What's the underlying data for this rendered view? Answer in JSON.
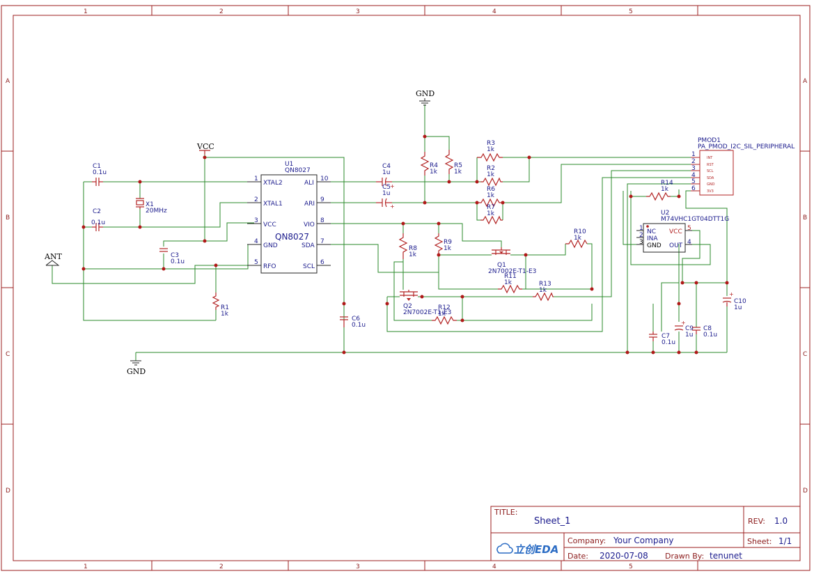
{
  "zones": {
    "columns": [
      "1",
      "2",
      "3",
      "4",
      "5"
    ],
    "rows": [
      "A",
      "B",
      "C",
      "D"
    ]
  },
  "labels": {
    "vcc": "VCC",
    "gnd_top": "GND",
    "gnd_bottom": "GND",
    "ant": "ANT"
  },
  "u1": {
    "ref": "U1",
    "part": "QN8027",
    "body_name": "QN8027",
    "left_pins": [
      {
        "num": "1",
        "name": "XTAL2"
      },
      {
        "num": "2",
        "name": "XTAL1"
      },
      {
        "num": "3",
        "name": "VCC"
      },
      {
        "num": "4",
        "name": "GND"
      },
      {
        "num": "5",
        "name": "RFO"
      }
    ],
    "right_pins": [
      {
        "num": "10",
        "name": "ALI"
      },
      {
        "num": "9",
        "name": "ARI"
      },
      {
        "num": "8",
        "name": "VIO"
      },
      {
        "num": "7",
        "name": "SDA"
      },
      {
        "num": "6",
        "name": "SCL"
      }
    ]
  },
  "u2": {
    "ref": "U2",
    "part": "M74VHC1GT04DTT1G",
    "pins": [
      {
        "num": "1",
        "name": "NC"
      },
      {
        "num": "2",
        "name": "INA"
      },
      {
        "num": "3",
        "name": "GND"
      },
      {
        "num": "5",
        "name": "VCC"
      },
      {
        "num": "4",
        "name": "OUT"
      }
    ]
  },
  "pmod": {
    "ref": "PMOD1",
    "part": "PA_PMOD_I2C_SIL_PERIPHERAL",
    "pins": [
      {
        "num": "1",
        "name": "INT"
      },
      {
        "num": "2",
        "name": "RST"
      },
      {
        "num": "3",
        "name": "SCL"
      },
      {
        "num": "4",
        "name": "SDA"
      },
      {
        "num": "5",
        "name": "GND"
      },
      {
        "num": "6",
        "name": "3V3"
      }
    ]
  },
  "components": {
    "c1": {
      "ref": "C1",
      "value": "0.1u"
    },
    "c2": {
      "ref": "C2",
      "value": "0.1u"
    },
    "c3": {
      "ref": "C3",
      "value": "0.1u"
    },
    "c4": {
      "ref": "C4",
      "value": "1u"
    },
    "c5": {
      "ref": "C5",
      "value": "1u"
    },
    "c6": {
      "ref": "C6",
      "value": "0.1u"
    },
    "c7": {
      "ref": "C7",
      "value": "0.1u"
    },
    "c8": {
      "ref": "C8",
      "value": "0.1u"
    },
    "c9": {
      "ref": "C9",
      "value": "1u"
    },
    "c10": {
      "ref": "C10",
      "value": "1u"
    },
    "x1": {
      "ref": "X1",
      "value": "20MHz"
    },
    "r1": {
      "ref": "R1",
      "value": "1k"
    },
    "r2": {
      "ref": "R2",
      "value": "1k"
    },
    "r3": {
      "ref": "R3",
      "value": "1k"
    },
    "r4": {
      "ref": "R4",
      "value": "1k"
    },
    "r5": {
      "ref": "R5",
      "value": "1k"
    },
    "r6": {
      "ref": "R6",
      "value": "1k"
    },
    "r7": {
      "ref": "R7",
      "value": "1k"
    },
    "r8": {
      "ref": "R8",
      "value": "1k"
    },
    "r9": {
      "ref": "R9",
      "value": "1k"
    },
    "r10": {
      "ref": "R10",
      "value": "1k"
    },
    "r11": {
      "ref": "R11",
      "value": "1k"
    },
    "r12": {
      "ref": "R12",
      "value": "1k"
    },
    "r13": {
      "ref": "R13",
      "value": "1k"
    },
    "r14": {
      "ref": "R14",
      "value": "1k"
    },
    "q1": {
      "ref": "Q1",
      "value": "2N7002E-T1-E3"
    },
    "q2": {
      "ref": "Q2",
      "value": "2N7002E-T1-E3"
    }
  },
  "title_block": {
    "title_label": "TITLE:",
    "title": "Sheet_1",
    "rev_label": "REV:",
    "rev": "1.0",
    "logo_text": "立创EDA",
    "company_label": "Company:",
    "company": "Your Company",
    "sheet_label": "Sheet:",
    "sheet": "1/1",
    "date_label": "Date:",
    "date": "2020-07-08",
    "drawn_label": "Drawn By:",
    "drawn_by": "tenunet"
  }
}
